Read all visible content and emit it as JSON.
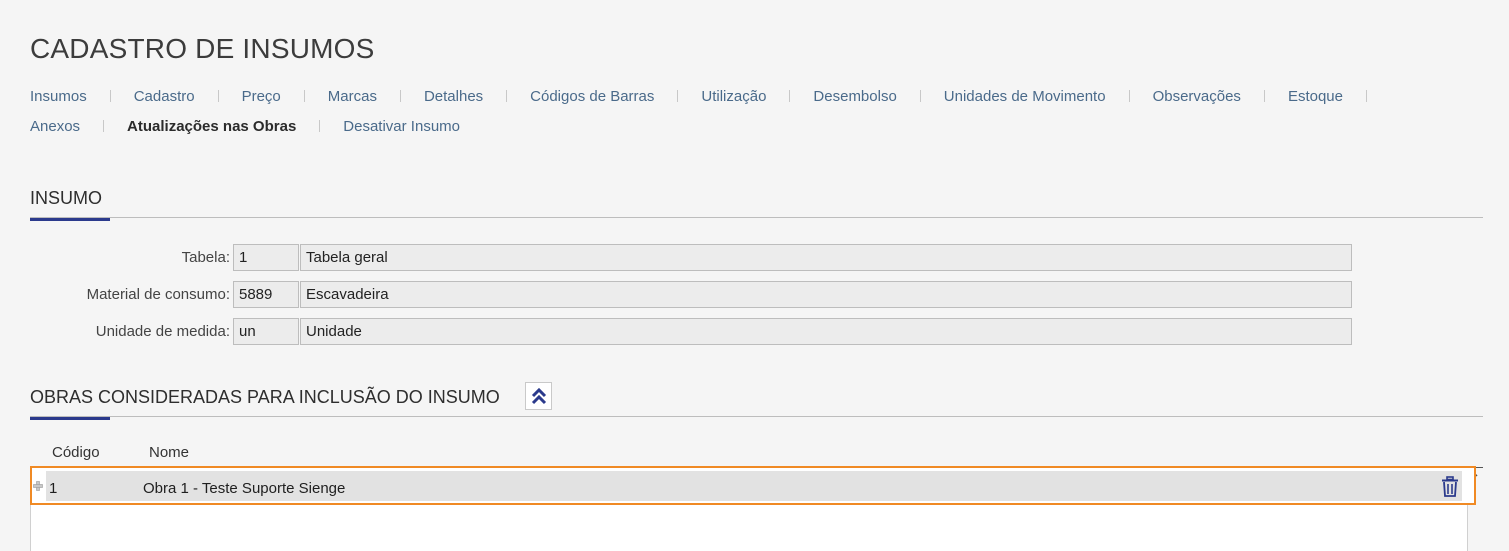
{
  "page": {
    "title": "CADASTRO DE INSUMOS"
  },
  "nav": {
    "row1": [
      "Insumos",
      "Cadastro",
      "Preço",
      "Marcas",
      "Detalhes",
      "Códigos de Barras",
      "Utilização",
      "Desembolso",
      "Unidades de Movimento",
      "Observações",
      "Estoque"
    ],
    "row2": [
      "Anexos",
      "Atualizações nas Obras",
      "Desativar Insumo"
    ],
    "active": "Atualizações nas Obras"
  },
  "insumo_section": {
    "title": "INSUMO",
    "fields": [
      {
        "label": "Tabela:",
        "code": "1",
        "description": "Tabela geral"
      },
      {
        "label": "Material de consumo:",
        "code": "5889",
        "description": "Escavadeira"
      },
      {
        "label": "Unidade de medida:",
        "code": "un",
        "description": "Unidade"
      }
    ]
  },
  "obras_section": {
    "title": "OBRAS CONSIDERADAS PARA INCLUSÃO DO INSUMO",
    "collapse_icon": "double-chevron-up-icon",
    "columns": {
      "code": "Código",
      "name": "Nome"
    },
    "rows": [
      {
        "code": "1",
        "name": "Obra 1 - Teste Suporte Sienge"
      }
    ],
    "delete_icon": "trash-icon"
  },
  "colors": {
    "accent": "#2b3a8c",
    "highlight": "#f08a24",
    "link": "#4a6a8a"
  }
}
